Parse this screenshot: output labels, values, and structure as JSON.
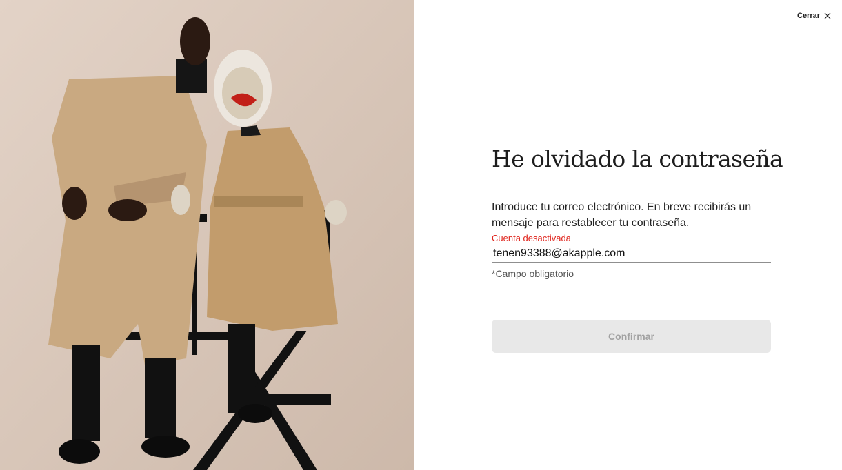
{
  "header": {
    "close_label": "Cerrar"
  },
  "form": {
    "title": "He olvidado la contraseña",
    "description": "Introduce tu correo electrónico. En breve recibirás un mensaje para restablecer tu contraseña,",
    "error_text": "Cuenta desactivada",
    "email_value": "tenen93388@akapple.com",
    "required_hint": "*Campo obligatorio",
    "confirm_label": "Confirmar"
  },
  "colors": {
    "error": "#e0261e",
    "button_bg": "#e8e8e8",
    "button_text": "#a2a2a2",
    "photo_bg": "#d9c8bb"
  },
  "icons": {
    "close": "close-icon"
  }
}
